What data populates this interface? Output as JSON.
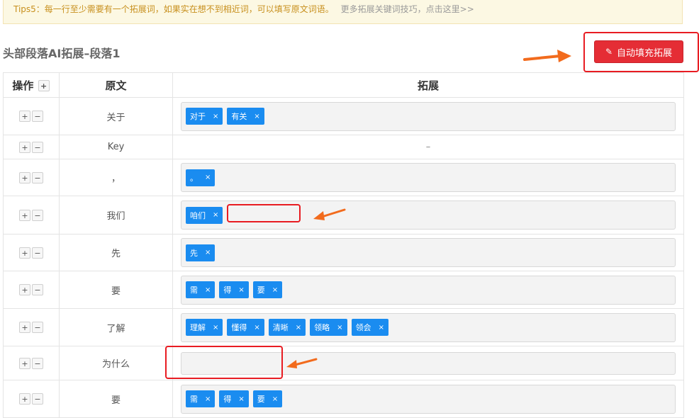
{
  "tips": {
    "text": "Tips5：每一行至少需要有一个拓展词，如果实在想不到相近词，可以填写原文词语。",
    "more_link": "更多拓展关键词技巧，点击这里>>"
  },
  "section": {
    "title": "头部段落AI拓展–段落1",
    "autofill_label": "自动填充拓展"
  },
  "table": {
    "headers": {
      "ops": "操作",
      "source": "原文",
      "expand": "拓展"
    },
    "plus": "+",
    "minus": "−",
    "remove": "×",
    "rows": [
      {
        "source": "关于",
        "tags": [
          "对于",
          "有关"
        ]
      },
      {
        "source": "Key",
        "tags": null,
        "placeholder": "–"
      },
      {
        "source": "，",
        "tags": [
          "。"
        ]
      },
      {
        "source": "我们",
        "tags": [
          "咱们"
        ]
      },
      {
        "source": "先",
        "tags": [
          "先"
        ]
      },
      {
        "source": "要",
        "tags": [
          "需",
          "得",
          "要"
        ]
      },
      {
        "source": "了解",
        "tags": [
          "理解",
          "懂得",
          "清晰",
          "领略",
          "领会"
        ]
      },
      {
        "source": "为什么",
        "tags": []
      },
      {
        "source": "要",
        "tags": [
          "需",
          "得",
          "要"
        ]
      }
    ]
  },
  "colors": {
    "accent": "#1a8cf0",
    "danger": "#e52d35",
    "annotation": "#f26b1d"
  }
}
